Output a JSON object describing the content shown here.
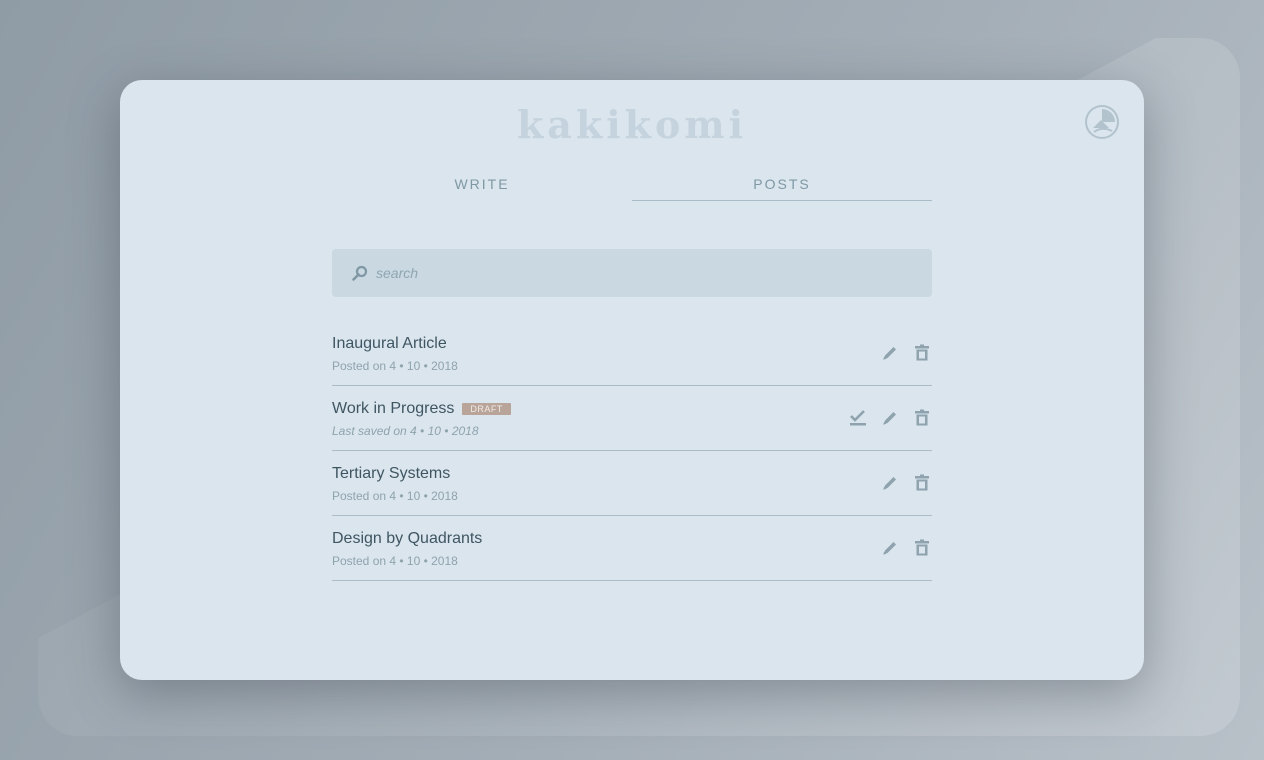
{
  "app": {
    "title": "kakikomi"
  },
  "tabs": [
    {
      "label": "WRITE",
      "active": false
    },
    {
      "label": "POSTS",
      "active": true
    }
  ],
  "search": {
    "placeholder": "search",
    "value": ""
  },
  "posts": [
    {
      "title": "Inaugural Article",
      "meta": "Posted on 4 • 10 • 2018",
      "draft": false,
      "actions": [
        "edit-icon",
        "trash-icon"
      ]
    },
    {
      "title": "Work in Progress",
      "badge": "DRAFT",
      "meta": "Last saved on 4 • 10 • 2018",
      "draft": true,
      "actions": [
        "publish-check-icon",
        "edit-icon",
        "trash-icon"
      ]
    },
    {
      "title": "Tertiary Systems",
      "meta": "Posted on 4 • 10 • 2018",
      "draft": false,
      "actions": [
        "edit-icon",
        "trash-icon"
      ]
    },
    {
      "title": "Design by Quadrants",
      "meta": "Posted on 4 • 10 • 2018",
      "draft": false,
      "actions": [
        "edit-icon",
        "trash-icon"
      ]
    }
  ],
  "colors": {
    "card_background": "#dae5ee",
    "accent": "#7f98a3",
    "draft_badge": "#b9a49a",
    "title_text": "#3f5662"
  }
}
